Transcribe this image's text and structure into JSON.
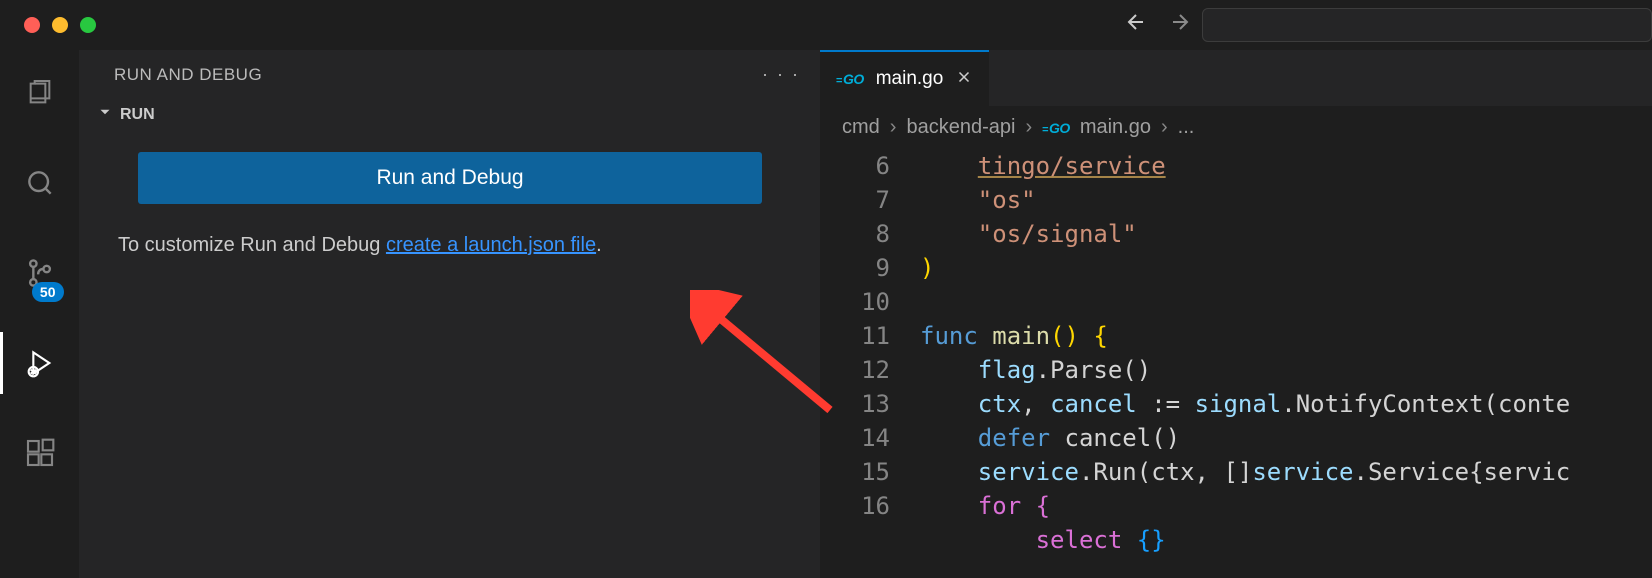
{
  "activity_bar": {
    "scm_badge": "50"
  },
  "sidebar": {
    "title": "RUN AND DEBUG",
    "section_label": "RUN",
    "run_button": "Run and Debug",
    "help_prefix": "To customize Run and Debug ",
    "help_link": "create a launch.json file",
    "help_suffix": "."
  },
  "editor": {
    "tab_file": "main.go",
    "breadcrumbs": {
      "0": "cmd",
      "1": "backend-api",
      "2": "main.go",
      "3": "..."
    },
    "gutter": {
      "6": "6",
      "7": "7",
      "8": "8",
      "9": "9",
      "10": "10",
      "11": "11",
      "12": "12",
      "13": "13",
      "14": "14",
      "15": "15",
      "16": "16"
    }
  },
  "code": {
    "line6": "tingo/service",
    "line7": "\"os\"",
    "line8": "\"os/signal\"",
    "line9": ")",
    "line11_func": "func",
    "line11_name": "main",
    "line11_rest": "() {",
    "line12_a": "flag",
    "line12_b": ".Parse()",
    "line13_a": "ctx",
    "line13_b": ", ",
    "line13_c": "cancel",
    "line13_d": " := ",
    "line13_e": "signal",
    "line13_f": ".NotifyContext(conte",
    "line14_a": "defer",
    "line14_b": " cancel()",
    "line15_a": "service",
    "line15_b": ".Run(ctx, []",
    "line15_c": "service",
    "line15_d": ".Service{servic",
    "line16_a": "for",
    "line16_b": " {",
    "line17_a": "select",
    "line17_b": " {}"
  }
}
